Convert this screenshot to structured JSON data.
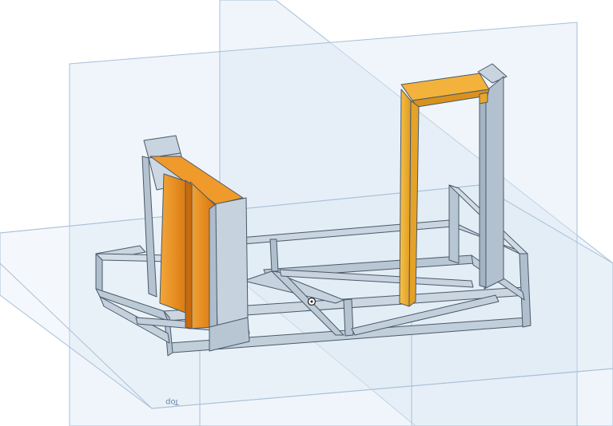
{
  "viewport": {
    "background_color": "#ffffff"
  },
  "planes": {
    "top_label": "Top",
    "plane_fill": "#dce8f4",
    "plane_edge": "#9fb6d2"
  },
  "model": {
    "frame_color": "#c3d0dc",
    "frame_edge": "#4a5968",
    "part_color": "#e78f1e",
    "part_color_light": "#f3b13c",
    "origin_marker": "origin-point"
  }
}
